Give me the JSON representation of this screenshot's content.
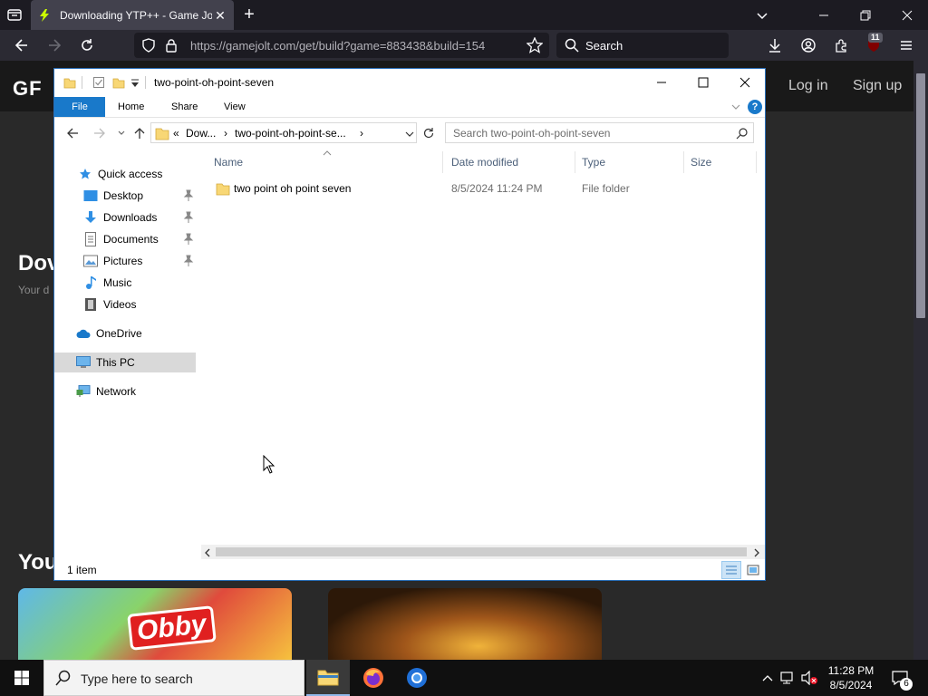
{
  "browser": {
    "tab_title": "Downloading YTP++ - Game Jolt",
    "tab_close": "✕",
    "new_tab": "+",
    "url": "https://gamejolt.com/get/build?game=883438&build=154",
    "search_placeholder": "Search",
    "extension_badge": "11"
  },
  "webpage": {
    "logo": "GF",
    "login": "Log in",
    "signup": "Sign up",
    "heading": "Dov",
    "subtext": "Your d",
    "section_heading": "You",
    "card1_text": "Obby"
  },
  "explorer": {
    "title": "two-point-oh-point-seven",
    "ribbon": {
      "file": "File",
      "home": "Home",
      "share": "Share",
      "view": "View",
      "help": "?"
    },
    "address": {
      "overflow": "«",
      "crumb1": "Dow...",
      "crumb2": "two-point-oh-point-se...",
      "sep": "›"
    },
    "search_placeholder": "Search two-point-oh-point-seven",
    "nav": {
      "quick_access": "Quick access",
      "desktop": "Desktop",
      "downloads": "Downloads",
      "documents": "Documents",
      "pictures": "Pictures",
      "music": "Music",
      "videos": "Videos",
      "onedrive": "OneDrive",
      "this_pc": "This PC",
      "network": "Network"
    },
    "columns": {
      "name": "Name",
      "date": "Date modified",
      "type": "Type",
      "size": "Size"
    },
    "files": [
      {
        "name": "two point oh point seven",
        "date": "8/5/2024 11:24 PM",
        "type": "File folder",
        "size": ""
      }
    ],
    "status": "1 item"
  },
  "taskbar": {
    "search_placeholder": "Type here to search",
    "time": "11:28 PM",
    "date": "8/5/2024",
    "notifications": "6"
  },
  "colors": {
    "accent": "#1979ca",
    "browser_bg": "#1c1b22",
    "folder": "#f8d775"
  }
}
